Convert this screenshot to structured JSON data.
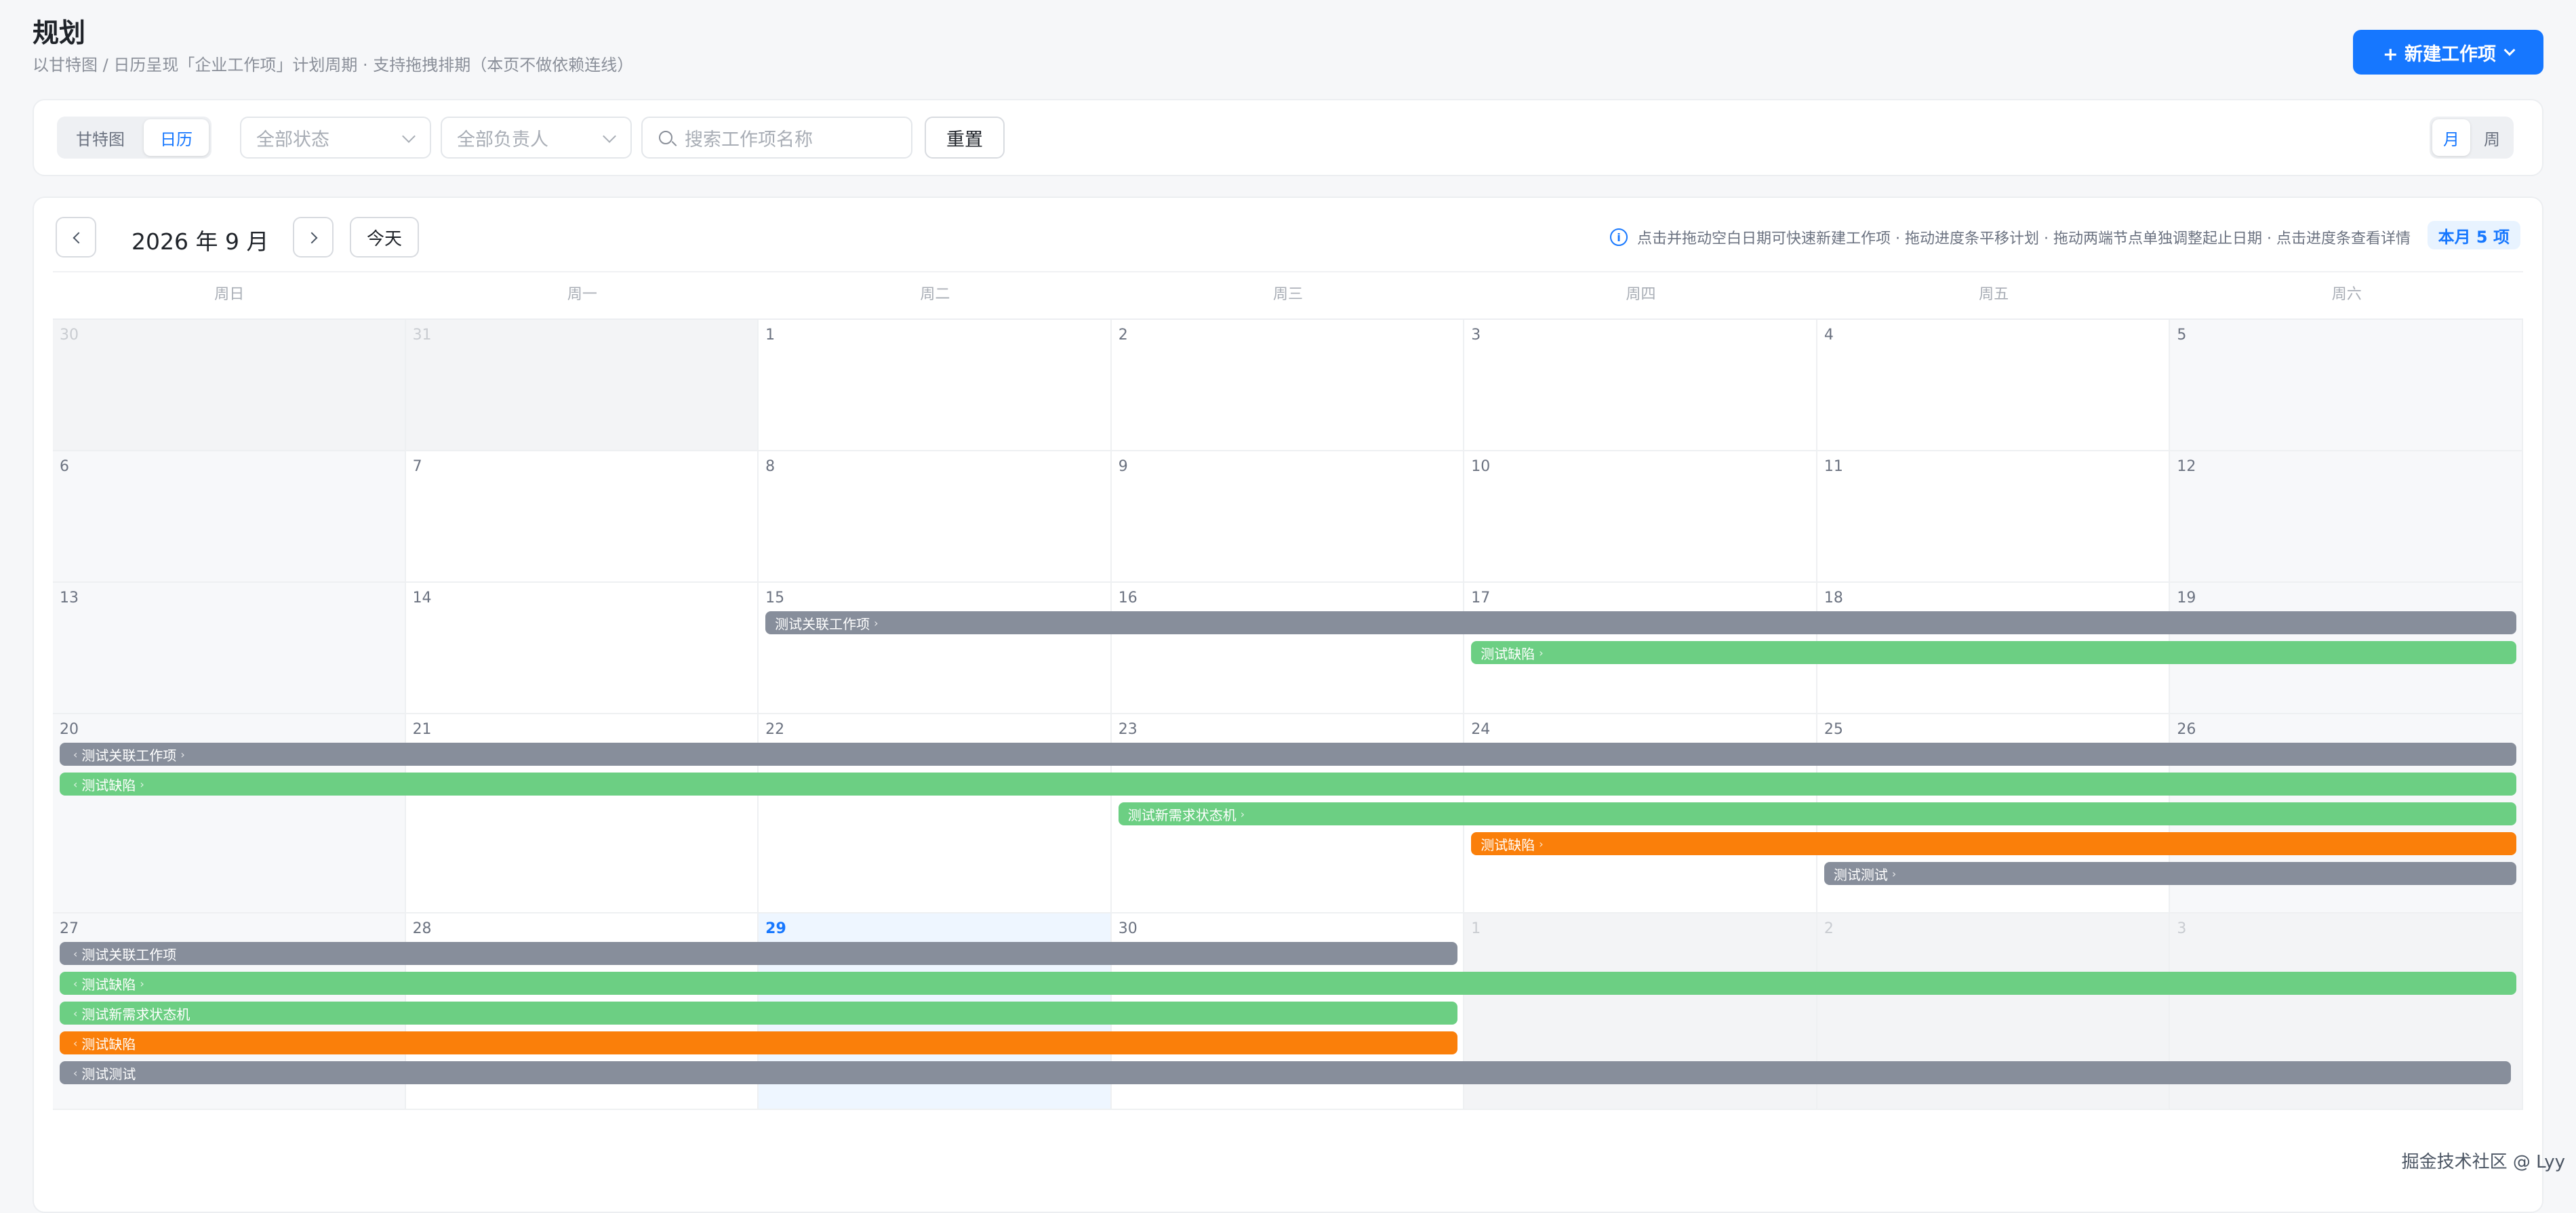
{
  "header": {
    "title": "规划",
    "subtitle": "以甘特图 / 日历呈现「企业工作项」计划周期 · 支持拖拽排期（本页不做依赖连线）",
    "new_button": "+ 新建工作项"
  },
  "filters": {
    "view_tabs": [
      "甘特图",
      "日历"
    ],
    "active_view": "日历",
    "status_placeholder": "全部状态",
    "owner_placeholder": "全部负责人",
    "search_placeholder": "搜索工作项名称",
    "reset_label": "重置",
    "scale_tabs": [
      "月",
      "周"
    ],
    "active_scale": "月"
  },
  "calendar": {
    "month_label": "2026 年 9 月",
    "today_label": "今天",
    "hint": "点击并拖动空白日期可快速新建工作项 · 拖动进度条平移计划 · 拖动两端节点单独调整起止日期 · 点击进度条查看详情",
    "count_badge": "本月 5 项",
    "weekdays": [
      "周日",
      "周一",
      "周二",
      "周三",
      "周四",
      "周五",
      "周六"
    ],
    "days": [
      [
        "30",
        "31",
        "1",
        "2",
        "3",
        "4",
        "5"
      ],
      [
        "6",
        "7",
        "8",
        "9",
        "10",
        "11",
        "12"
      ],
      [
        "13",
        "14",
        "15",
        "16",
        "17",
        "18",
        "19"
      ],
      [
        "20",
        "21",
        "22",
        "23",
        "24",
        "25",
        "26"
      ],
      [
        "27",
        "28",
        "29",
        "30",
        "1",
        "2",
        "3"
      ]
    ],
    "today": "2026-09-29",
    "tasks": [
      {
        "name": "测试关联工作项",
        "color": "#878e9b",
        "start": "2026-09-15",
        "end": "2026-09-30"
      },
      {
        "name": "测试缺陷",
        "color": "#6ccf83",
        "start": "2026-09-17",
        "end": "2026-10-03+"
      },
      {
        "name": "测试新需求状态机",
        "color": "#6ccf83",
        "start": "2026-09-23",
        "end": "2026-09-30"
      },
      {
        "name": "测试缺陷",
        "color": "#fa7f0a",
        "start": "2026-09-24",
        "end": "2026-09-30"
      },
      {
        "name": "测试测试",
        "color": "#878e9b",
        "start": "2026-09-25",
        "end": "2026-10-03"
      }
    ]
  },
  "watermark": "掘金技术社区 @ Lyy"
}
